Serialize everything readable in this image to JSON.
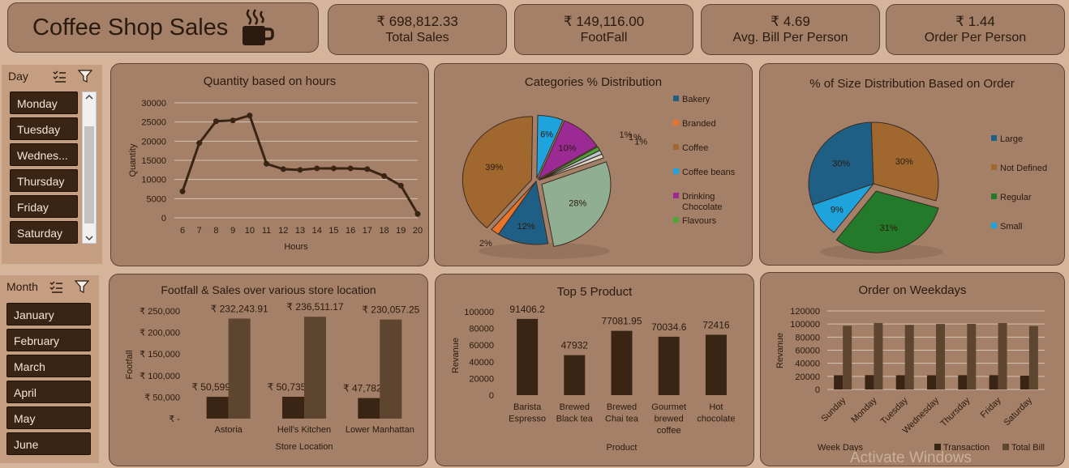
{
  "header": {
    "title": "Coffee Shop Sales",
    "icon": "coffee-cup-icon"
  },
  "kpis": [
    {
      "value": "₹ 698,812.33",
      "label": "Total Sales"
    },
    {
      "value": "₹ 149,116.00",
      "label": "FootFall"
    },
    {
      "value": "₹ 4.69",
      "label": "Avg. Bill Per Person"
    },
    {
      "value": "₹ 1.44",
      "label": "Order Per Person"
    }
  ],
  "day_slicer": {
    "header": "Day",
    "items": [
      "Monday",
      "Tuesday",
      "Wednes...",
      "Thursday",
      "Friday",
      "Saturday"
    ]
  },
  "month_slicer": {
    "header": "Month",
    "items": [
      "January",
      "February",
      "March",
      "April",
      "May",
      "June"
    ]
  },
  "watermark": "Activate Windows",
  "chart_data": [
    {
      "type": "line",
      "title": "Quantity based on hours",
      "xlabel": "Hours",
      "ylabel": "Quantity",
      "x": [
        6,
        7,
        8,
        9,
        10,
        11,
        12,
        13,
        14,
        15,
        16,
        17,
        18,
        19,
        20
      ],
      "values": [
        6900,
        19500,
        25200,
        25400,
        26700,
        14100,
        12700,
        12500,
        12900,
        12900,
        12900,
        12700,
        10900,
        8400,
        1000
      ],
      "yticks": [
        "0",
        "5000",
        "10000",
        "15000",
        "20000",
        "25000",
        "30000"
      ],
      "ylim": [
        0,
        30000
      ],
      "grid": true,
      "color": "#3a2414"
    },
    {
      "type": "pie",
      "title": "Categories % Distribution",
      "slices": [
        {
          "name": "Bakery",
          "value": 12,
          "label": "12%",
          "color": "#1f5f85"
        },
        {
          "name": "Branded",
          "value": 2,
          "label": "2%",
          "color": "#e8732a"
        },
        {
          "name": "Coffee",
          "value": 39,
          "label": "39%",
          "color": "#a0682f"
        },
        {
          "name": "Coffee beans",
          "value": 6,
          "label": "6%",
          "color": "#1ea3dc"
        },
        {
          "name": "Drinking Chocolate",
          "value": 10,
          "label": "10%",
          "color": "#9b2a95"
        },
        {
          "name": "Flavours",
          "value": 1,
          "label": "1%",
          "color": "#4ea63a"
        },
        {
          "name": "",
          "value": 1,
          "label": "1%",
          "color": "#b7c7cc"
        },
        {
          "name": "",
          "value": 1,
          "label": "1%",
          "color": "#dfd6c8"
        },
        {
          "name": "",
          "value": 28,
          "label": "28%",
          "color": "#8fae92"
        }
      ],
      "legend": [
        "Bakery",
        "Branded",
        "Coffee",
        "Coffee beans",
        "Drinking Chocolate",
        "Flavours"
      ],
      "legend_position": "right"
    },
    {
      "type": "pie",
      "title": "% of Size Distribution Based on Order",
      "slices": [
        {
          "name": "Large",
          "value": 30,
          "label": "30%",
          "color": "#1f5f85"
        },
        {
          "name": "Not Defined",
          "value": 30,
          "label": "30%",
          "color": "#a0682f"
        },
        {
          "name": "Regular",
          "value": 31,
          "label": "31%",
          "color": "#237a2b"
        },
        {
          "name": "Small",
          "value": 9,
          "label": "9%",
          "color": "#1ea3dc"
        }
      ],
      "legend_position": "right"
    },
    {
      "type": "bar",
      "title": "Footfall & Sales over various store location",
      "xlabel": "Store Location",
      "ylabel": "Footfall",
      "categories": [
        "Astoria",
        "Hell's Kitchen",
        "Lower Manhattan"
      ],
      "series": [
        {
          "name": "",
          "values": [
            50599,
            50735,
            47782
          ],
          "labels": [
            "₹ 50,599",
            "₹ 50,735",
            "₹ 47,782"
          ],
          "color": "#3a2414"
        },
        {
          "name": "",
          "values": [
            232243.91,
            236511.17,
            230057.25
          ],
          "labels": [
            "₹ 232,243.91",
            "₹ 236,511.17",
            "₹ 230,057.25"
          ],
          "color": "#5e4530"
        }
      ],
      "yticks": [
        "₹ -",
        "₹ 50,000",
        "₹ 100,000",
        "₹ 150,000",
        "₹ 200,000",
        "₹ 250,000"
      ],
      "ylim": [
        0,
        250000
      ]
    },
    {
      "type": "bar",
      "title": "Top 5 Product",
      "xlabel": "Product",
      "ylabel": "Revanue",
      "categories": [
        [
          "Barista",
          "Espresso"
        ],
        [
          "Brewed",
          "Black tea"
        ],
        [
          "Brewed",
          "Chai tea"
        ],
        [
          "Gourmet",
          "brewed",
          "coffee"
        ],
        [
          "Hot",
          "chocolate"
        ]
      ],
      "values": [
        91406.2,
        47932,
        77081.95,
        70034.6,
        72416
      ],
      "value_labels": [
        "91406.2",
        "47932",
        "77081.95",
        "70034.6",
        "72416"
      ],
      "yticks": [
        "0",
        "20000",
        "40000",
        "60000",
        "80000",
        "100000"
      ],
      "ylim": [
        0,
        100000
      ],
      "color": "#3a2414"
    },
    {
      "type": "bar",
      "title": "Order on Weekdays",
      "xlabel": "Week Days",
      "ylabel": "Revanue",
      "categories": [
        "Sunday",
        "Monday",
        "Tuesday",
        "Wednesday",
        "Thursday",
        "Friday",
        "Saturday"
      ],
      "series": [
        {
          "name": "Transaction",
          "values": [
            21700,
            21900,
            21700,
            21700,
            21800,
            21800,
            21000
          ],
          "color": "#3a2414"
        },
        {
          "name": "Total Bill",
          "values": [
            97300,
            101500,
            98600,
            100100,
            100200,
            101400,
            96900
          ],
          "color": "#5e4530"
        }
      ],
      "yticks": [
        "0",
        "20000",
        "40000",
        "60000",
        "80000",
        "100000",
        "120000"
      ],
      "ylim": [
        0,
        120000
      ],
      "legend_position": "bottom"
    }
  ]
}
